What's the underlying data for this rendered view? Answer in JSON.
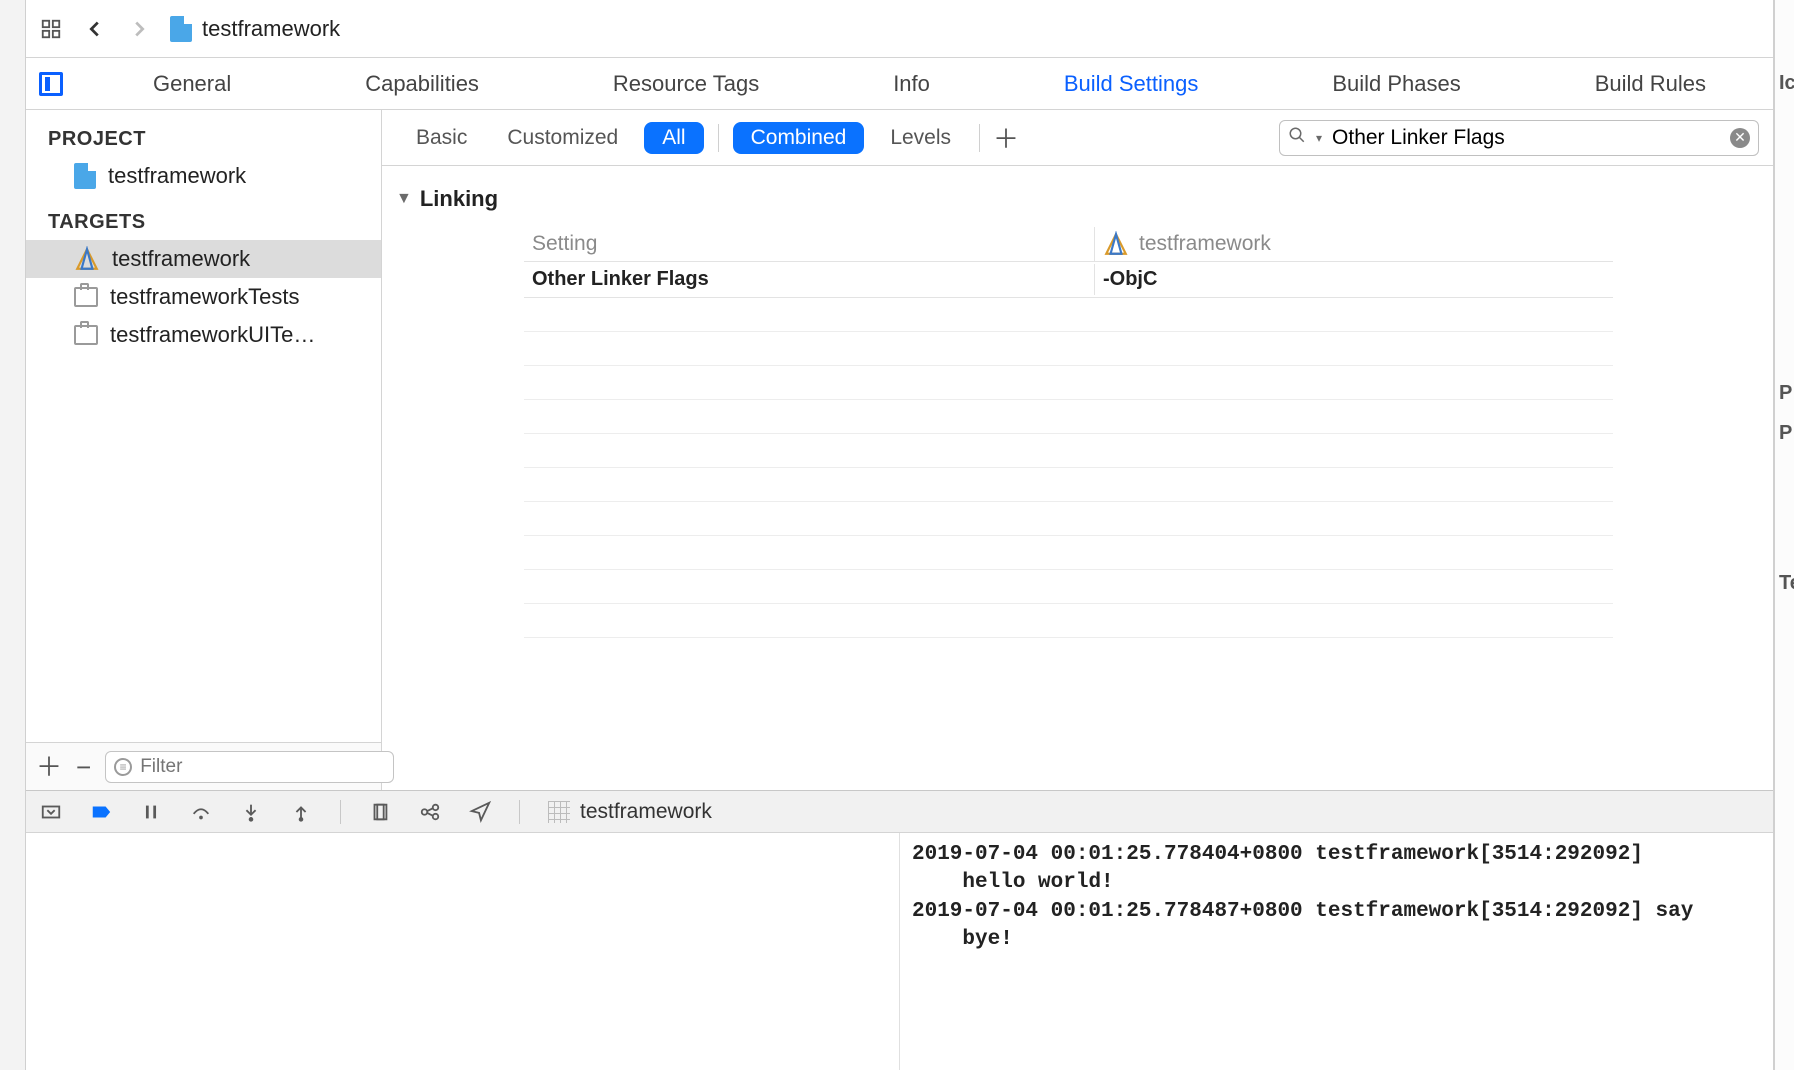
{
  "breadcrumb": {
    "project_name": "testframework"
  },
  "tabs": {
    "items": [
      "General",
      "Capabilities",
      "Resource Tags",
      "Info",
      "Build Settings",
      "Build Phases",
      "Build Rules"
    ],
    "active_index": 4
  },
  "sidebar": {
    "project_header": "PROJECT",
    "project_items": [
      {
        "label": "testframework"
      }
    ],
    "targets_header": "TARGETS",
    "target_items": [
      {
        "label": "testframework",
        "selected": true,
        "icon": "app"
      },
      {
        "label": "testframeworkTests",
        "selected": false,
        "icon": "test"
      },
      {
        "label": "testframeworkUITe…",
        "selected": false,
        "icon": "test"
      }
    ],
    "filter_placeholder": "Filter"
  },
  "filter_bar": {
    "basic": "Basic",
    "customized": "Customized",
    "all": "All",
    "combined": "Combined",
    "levels": "Levels",
    "search_value": "Other Linker Flags"
  },
  "settings": {
    "group_title": "Linking",
    "setting_header": "Setting",
    "target_header": "testframework",
    "rows": [
      {
        "name": "Other Linker Flags",
        "value": "-ObjC"
      }
    ]
  },
  "debug": {
    "process_name": "testframework",
    "console_text": "2019-07-04 00:01:25.778404+0800 testframework[3514:292092] \n    hello world!\n2019-07-04 00:01:25.778487+0800 testframework[3514:292092] say \n    bye!"
  },
  "right_panel_fragments": [
    "Ic",
    "P",
    "P",
    "Te"
  ]
}
